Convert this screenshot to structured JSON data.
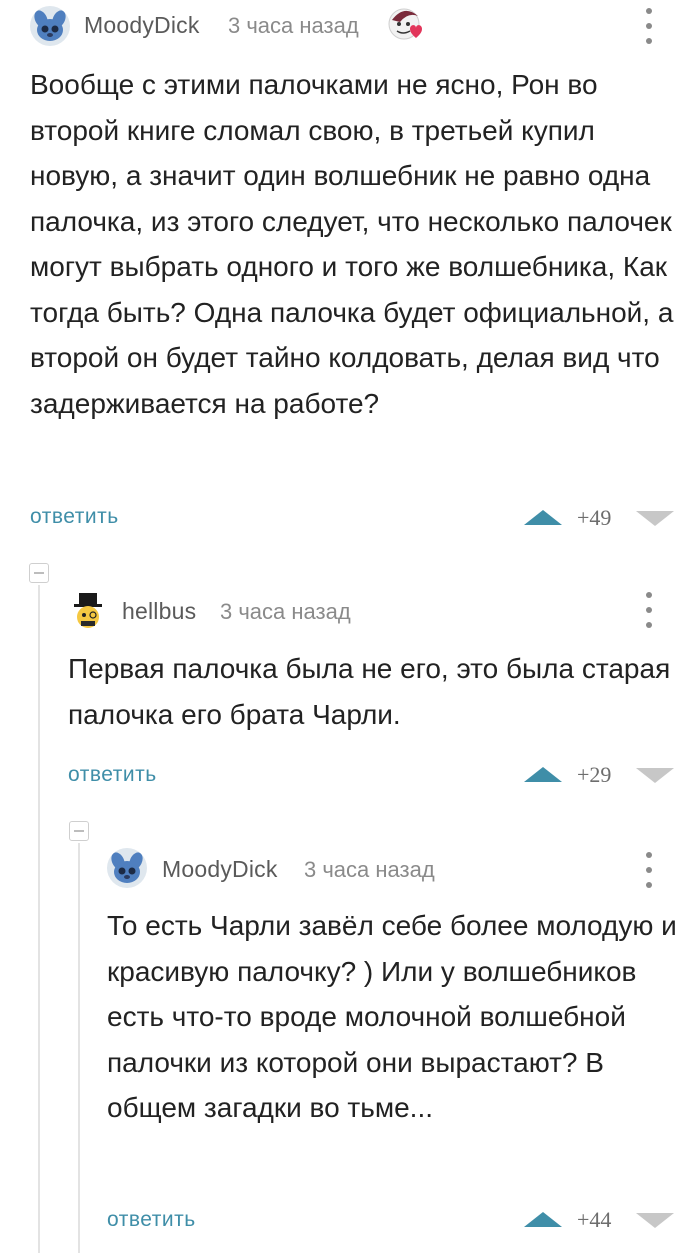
{
  "comments": [
    {
      "user": "MoodyDick",
      "time": "3 часа назад",
      "text": "Вообще с этими палочками не ясно, Рон во второй книге сломал свою, в третьей купил новую, а значит один волшебник не равно одна палочка, из этого следует, что несколько палочек могут выбрать одного и того же волшебника, Как тогда быть? Одна палочка будет официальной, а второй он будет тайно колдовать, делая вид что задерживается на работе?",
      "reply_label": "ответить",
      "score": "+49"
    },
    {
      "user": "hellbus",
      "time": "3 часа назад",
      "text": "Первая палочка была не его, это была старая палочка его брата Чарли.",
      "reply_label": "ответить",
      "score": "+29"
    },
    {
      "user": "MoodyDick",
      "time": "3 часа назад",
      "text": "То есть Чарли завёл себе более молодую и красивую палочку? ) Или у волшебников есть что-то вроде молочной волшебной палочки из которой они вырастают? В общем загадки во тьме...",
      "reply_label": "ответить",
      "score": "+44"
    }
  ],
  "colors": {
    "accent": "#3f8ea8",
    "vote_down": "#c7c7c7",
    "meta_text": "#8a8a8a"
  },
  "icons": [
    "avatar-stitch",
    "avatar-top-hat",
    "heart-badge",
    "more-vertical-icon",
    "upvote-icon",
    "downvote-icon",
    "collapse-thread-icon"
  ]
}
